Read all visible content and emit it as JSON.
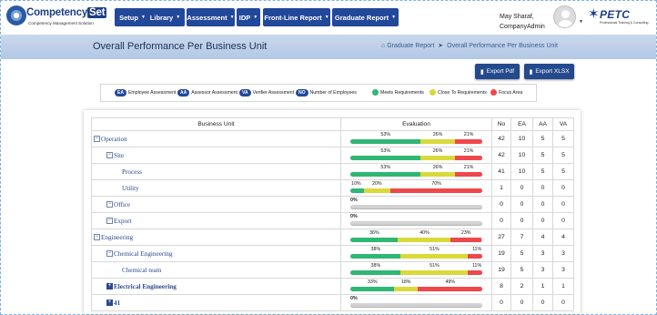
{
  "app": {
    "logo_main": "Competency",
    "logo_set": "Set",
    "logo_sub": "Competency Management Solution"
  },
  "nav": [
    {
      "label": "Setup"
    },
    {
      "label": "Library"
    },
    {
      "label": "Assessment"
    },
    {
      "label": "IDP"
    },
    {
      "label": "Front-Line Report"
    },
    {
      "label": "Graduate Report"
    }
  ],
  "user": {
    "name": "May Sharaf,",
    "role": "CompanyAdmin"
  },
  "partner_logo": {
    "word": "PETC",
    "sub": "Professional Training & Consulting"
  },
  "page": {
    "title": "Overall Performance Per Business Unit"
  },
  "breadcrumb": [
    {
      "label": "Graduate Report"
    },
    {
      "label": "Overall Performance Per Business Unit"
    }
  ],
  "actions": {
    "export_pdf": "Export Pdf",
    "export_xlsx": "Export XLSX"
  },
  "legend": {
    "tags": [
      {
        "abbr": "EA",
        "label": "Employee Assessment"
      },
      {
        "abbr": "AA",
        "label": "Assessor Assessment"
      },
      {
        "abbr": "VA",
        "label": "Verifier Assessment"
      },
      {
        "abbr": "NO",
        "label": "Number of Employees"
      }
    ],
    "statuses": [
      {
        "label": "Meets Requirements",
        "color": "#2fb774"
      },
      {
        "label": "Close To Requirements",
        "color": "#d9d93a"
      },
      {
        "label": "Focus Area",
        "color": "#f0474b"
      }
    ]
  },
  "table": {
    "headers": [
      "Business Unit",
      "Evaluation",
      "No",
      "EA",
      "AA",
      "VA"
    ],
    "rows": [
      {
        "name": "Operation",
        "level": 0,
        "expander": "minus",
        "meets": 53,
        "close": 26,
        "focus": 21,
        "no": "42",
        "ea": "10",
        "aa": "5",
        "va": "5"
      },
      {
        "name": "Site",
        "level": 1,
        "expander": "minus",
        "meets": 53,
        "close": 26,
        "focus": 21,
        "no": "42",
        "ea": "10",
        "aa": "5",
        "va": "5"
      },
      {
        "name": "Process",
        "level": 2,
        "expander": "",
        "meets": 53,
        "close": 26,
        "focus": 21,
        "no": "41",
        "ea": "10",
        "aa": "5",
        "va": "5"
      },
      {
        "name": "Utility",
        "level": 2,
        "expander": "",
        "meets": 10,
        "close": 20,
        "focus": 70,
        "no": "1",
        "ea": "0",
        "aa": "0",
        "va": "0"
      },
      {
        "name": "Office",
        "level": 1,
        "expander": "minus",
        "meets": 0,
        "close": 0,
        "focus": 0,
        "no": "0",
        "ea": "0",
        "aa": "0",
        "va": "0"
      },
      {
        "name": "Export",
        "level": 1,
        "expander": "minus",
        "meets": 0,
        "close": 0,
        "focus": 0,
        "no": "0",
        "ea": "0",
        "aa": "0",
        "va": "0"
      },
      {
        "name": "Engineering",
        "level": 0,
        "expander": "minus",
        "meets": 36,
        "close": 40,
        "focus": 23,
        "no": "27",
        "ea": "7",
        "aa": "4",
        "va": "4"
      },
      {
        "name": "Chemical Engineering",
        "level": 1,
        "expander": "minus",
        "meets": 38,
        "close": 51,
        "focus": 11,
        "no": "19",
        "ea": "5",
        "aa": "3",
        "va": "3"
      },
      {
        "name": "Chemical team",
        "level": 2,
        "expander": "",
        "meets": 38,
        "close": 51,
        "focus": 11,
        "no": "19",
        "ea": "5",
        "aa": "3",
        "va": "3"
      },
      {
        "name": "Electrical Engineering",
        "level": 1,
        "expander": "plus",
        "meets": 33,
        "close": 18,
        "focus": 49,
        "no": "8",
        "ea": "2",
        "aa": "1",
        "va": "1"
      },
      {
        "name": "41",
        "level": 1,
        "expander": "plus",
        "meets": 0,
        "close": 0,
        "focus": 0,
        "no": "0",
        "ea": "0",
        "aa": "0",
        "va": "0"
      }
    ]
  }
}
